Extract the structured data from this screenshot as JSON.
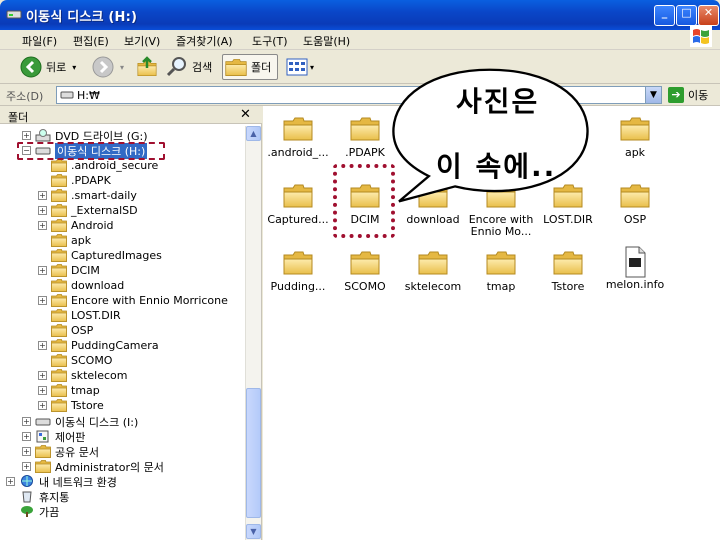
{
  "window": {
    "title": "이동식 디스크 (H:)"
  },
  "menu": {
    "items": [
      "파일(F)",
      "편집(E)",
      "보기(V)",
      "즐겨찾기(A)",
      "도구(T)",
      "도움말(H)"
    ]
  },
  "toolbar": {
    "back_label": "뒤로",
    "search_label": "검색",
    "folders_label": "폴더"
  },
  "address": {
    "label": "주소(D)",
    "value": "H:₩",
    "go_label": "이동"
  },
  "left_panel": {
    "title": "폴더",
    "tree": [
      {
        "label": "DVD 드라이브 (G:)"
      },
      {
        "label": "이동식 디스크 (H:)"
      },
      {
        "label": ".android_secure"
      },
      {
        "label": ".PDAPK"
      },
      {
        "label": ".smart-daily"
      },
      {
        "label": "_ExternalSD"
      },
      {
        "label": "Android"
      },
      {
        "label": "apk"
      },
      {
        "label": "CapturedImages"
      },
      {
        "label": "DCIM"
      },
      {
        "label": "download"
      },
      {
        "label": "Encore with Ennio Morricone"
      },
      {
        "label": "LOST.DIR"
      },
      {
        "label": "OSP"
      },
      {
        "label": "PuddingCamera"
      },
      {
        "label": "SCOMO"
      },
      {
        "label": "sktelecom"
      },
      {
        "label": "tmap"
      },
      {
        "label": "Tstore"
      },
      {
        "label": "이동식 디스크 (I:)"
      },
      {
        "label": "제어판"
      },
      {
        "label": "공유 문서"
      },
      {
        "label": "Administrator의 문서"
      },
      {
        "label": "내 네트워크 환경"
      },
      {
        "label": "휴지통"
      },
      {
        "label": "가끔"
      }
    ]
  },
  "content": {
    "items": [
      {
        "label": ".android_..."
      },
      {
        "label": ".PDAPK"
      },
      {
        "label": "apk"
      },
      {
        "label": "Captured..."
      },
      {
        "label": "DCIM"
      },
      {
        "label": "download"
      },
      {
        "label": "Encore with Ennio Mo..."
      },
      {
        "label": "LOST.DIR"
      },
      {
        "label": "OSP"
      },
      {
        "label": "Pudding..."
      },
      {
        "label": "SCOMO"
      },
      {
        "label": "sktelecom"
      },
      {
        "label": "tmap"
      },
      {
        "label": "Tstore"
      },
      {
        "label": "melon.info"
      }
    ]
  },
  "annotation": {
    "line1": "사진은",
    "line2": "이 속에.."
  },
  "colors": {
    "titlebar": "#0a46c8",
    "selection": "#316ac5",
    "annotation_outline": "#a01030",
    "folder": "#f5d36a"
  }
}
